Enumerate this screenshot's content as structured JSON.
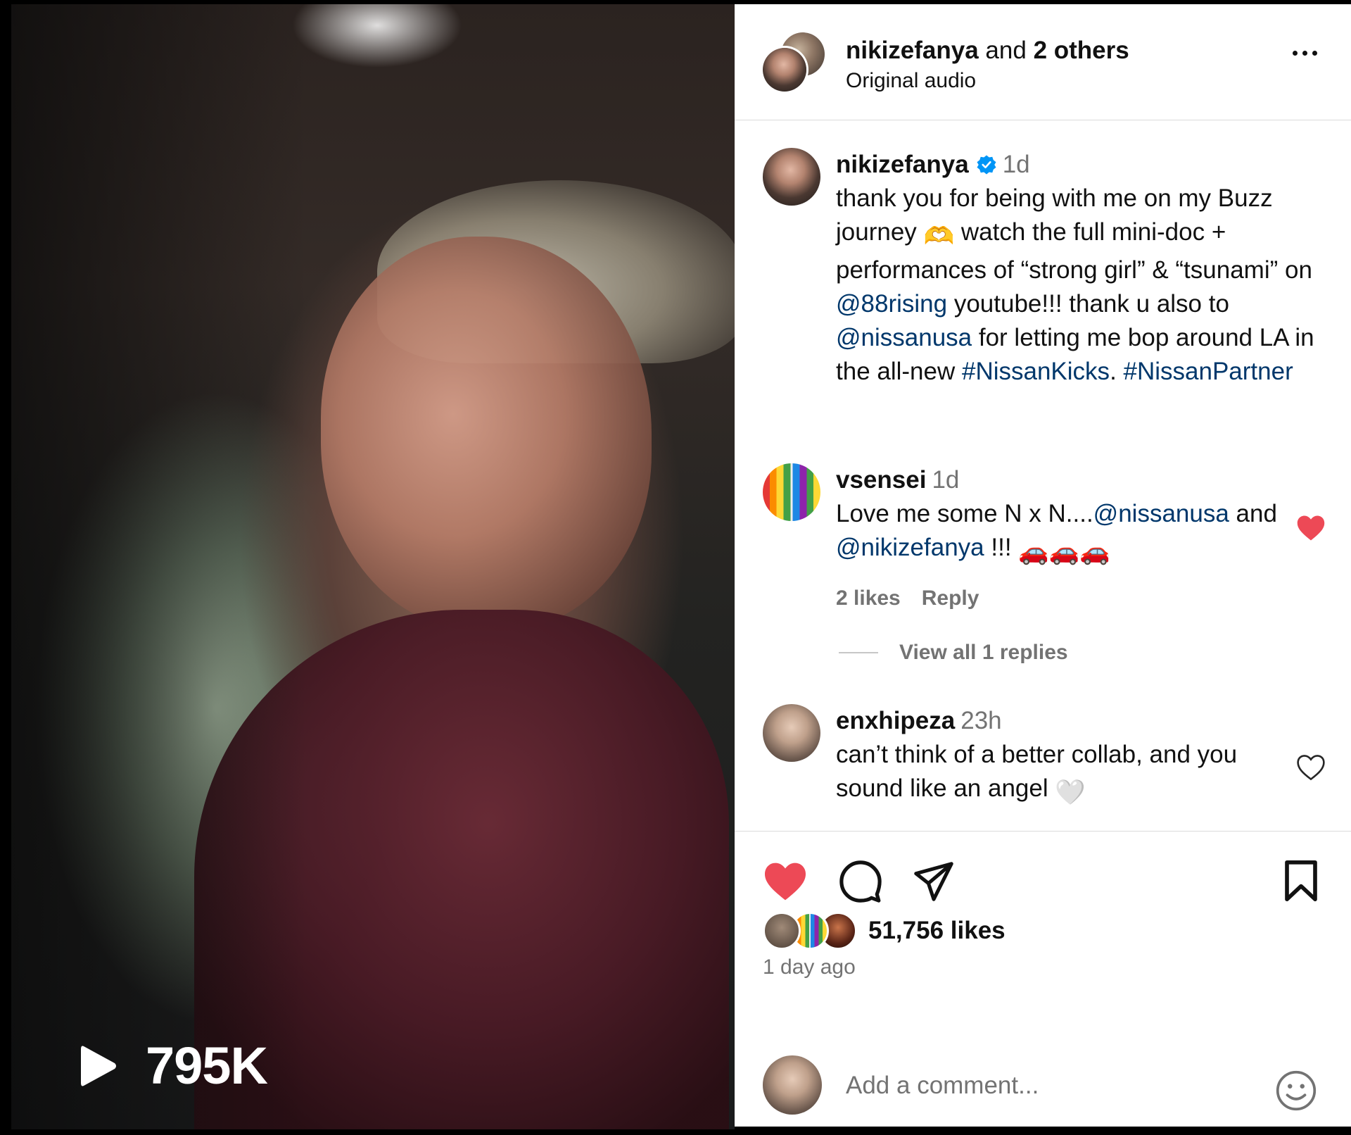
{
  "video": {
    "play_count": "795K",
    "play_icon": "play-icon"
  },
  "header": {
    "author": "nikizefanya",
    "and_text": " and ",
    "others": "2 others",
    "audio": "Original audio",
    "more_icon": "more-options-icon"
  },
  "caption": {
    "username": "nikizefanya",
    "time": "1d",
    "t1": "thank you for being with me on my Buzz journey ",
    "emoji1": "🫶",
    "t2": " watch the full mini-doc + performances of “strong girl” & “tsunami” on ",
    "m1": "@88rising",
    "t3": " youtube!!! thank u also to ",
    "m2": "@nissanusa",
    "t4": " for letting me bop around LA in the all-new ",
    "h1": "#NissanKicks",
    "t5": ". ",
    "h2": "#NissanPartner"
  },
  "comments": [
    {
      "username": "vsensei",
      "time": "1d",
      "t1": "Love me some N x N....",
      "m1": "@nissanusa",
      "t2": " and ",
      "m2": "@nikizefanya",
      "t3": " !!! ",
      "emoji": "🚗🚗🚗",
      "likes": "2 likes",
      "reply": "Reply",
      "view_replies": "View all 1 replies",
      "liked": true
    },
    {
      "username": "enxhipeza",
      "time": "23h",
      "text": "can’t think of a better collab, and you sound like an angel ",
      "emoji": "🤍",
      "liked": false
    }
  ],
  "actions": {
    "like_icon": "heart-filled-icon",
    "comment_icon": "comment-icon",
    "share_icon": "share-icon",
    "save_icon": "bookmark-icon",
    "likes": "51,756 likes",
    "ago": "1 day ago",
    "add_comment_placeholder": "Add a comment...",
    "emoji_icon": "emoji-icon"
  },
  "colors": {
    "link": "#00376b",
    "heart": "#ed4956",
    "muted": "#737373",
    "verified": "#0095f6"
  }
}
